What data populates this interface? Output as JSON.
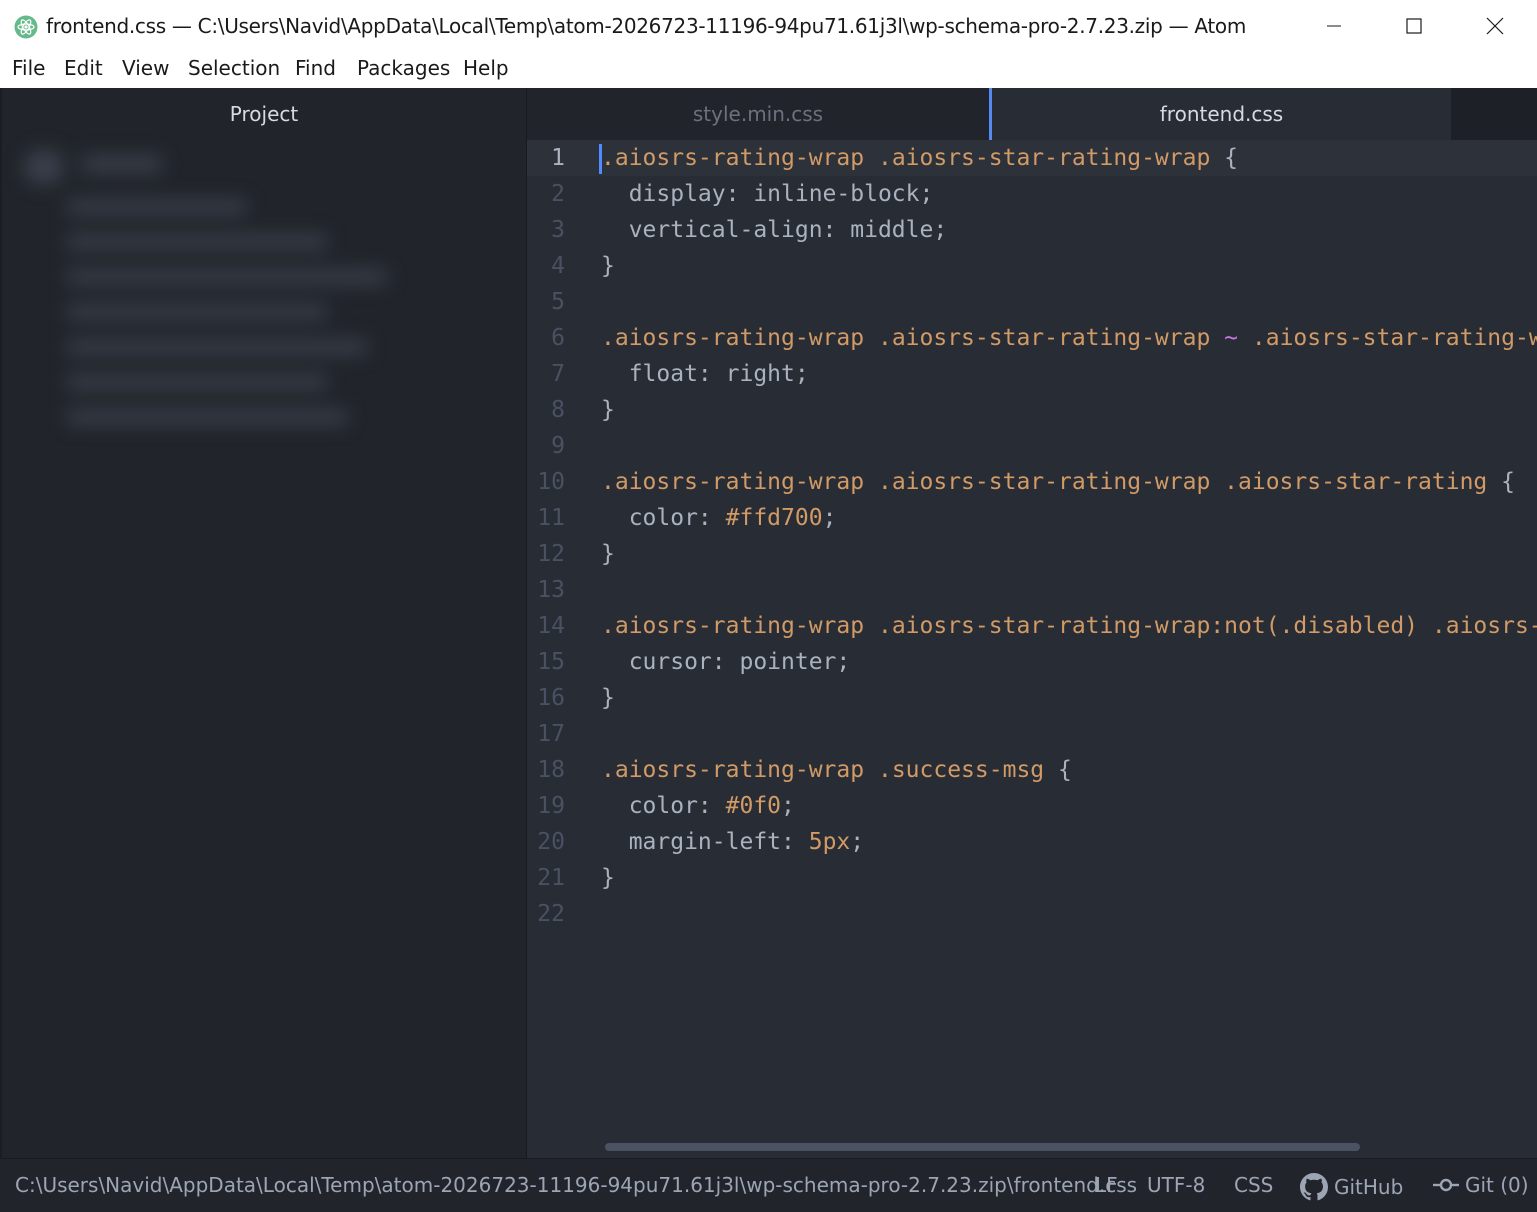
{
  "window": {
    "title": "frontend.css — C:\\Users\\Navid\\AppData\\Local\\Temp\\atom-2026723-11196-94pu71.61j3l\\wp-schema-pro-2.7.23.zip — Atom"
  },
  "menu": [
    "File",
    "Edit",
    "View",
    "Selection",
    "Find",
    "Packages",
    "Help"
  ],
  "project": {
    "header": "Project"
  },
  "tabs": [
    {
      "label": "style.min.css",
      "active": false
    },
    {
      "label": "frontend.css",
      "active": true
    }
  ],
  "editor": {
    "cursor_line": 1,
    "lines": [
      {
        "n": "1",
        "tokens": [
          {
            "t": ".aiosrs-rating-wrap",
            "c": "sel"
          },
          {
            "t": " ",
            "c": ""
          },
          {
            "t": ".aiosrs-star-rating-wrap",
            "c": "sel"
          },
          {
            "t": " {",
            "c": ""
          }
        ]
      },
      {
        "n": "2",
        "tokens": [
          {
            "t": "  display: inline-block;",
            "c": ""
          }
        ]
      },
      {
        "n": "3",
        "tokens": [
          {
            "t": "  vertical-align: middle;",
            "c": ""
          }
        ]
      },
      {
        "n": "4",
        "tokens": [
          {
            "t": "}",
            "c": ""
          }
        ]
      },
      {
        "n": "5",
        "tokens": []
      },
      {
        "n": "6",
        "tokens": [
          {
            "t": ".aiosrs-rating-wrap",
            "c": "sel"
          },
          {
            "t": " ",
            "c": ""
          },
          {
            "t": ".aiosrs-star-rating-wrap",
            "c": "sel"
          },
          {
            "t": " ",
            "c": ""
          },
          {
            "t": "~",
            "c": "tilde"
          },
          {
            "t": " ",
            "c": ""
          },
          {
            "t": ".aiosrs-star-rating-wra",
            "c": "sel"
          }
        ]
      },
      {
        "n": "7",
        "tokens": [
          {
            "t": "  float: right;",
            "c": ""
          }
        ]
      },
      {
        "n": "8",
        "tokens": [
          {
            "t": "}",
            "c": ""
          }
        ]
      },
      {
        "n": "9",
        "tokens": []
      },
      {
        "n": "10",
        "tokens": [
          {
            "t": ".aiosrs-rating-wrap",
            "c": "sel"
          },
          {
            "t": " ",
            "c": ""
          },
          {
            "t": ".aiosrs-star-rating-wrap",
            "c": "sel"
          },
          {
            "t": " ",
            "c": ""
          },
          {
            "t": ".aiosrs-star-rating",
            "c": "sel"
          },
          {
            "t": " {",
            "c": ""
          }
        ]
      },
      {
        "n": "11",
        "tokens": [
          {
            "t": "  color: ",
            "c": ""
          },
          {
            "t": "#ffd700",
            "c": "num"
          },
          {
            "t": ";",
            "c": ""
          }
        ]
      },
      {
        "n": "12",
        "tokens": [
          {
            "t": "}",
            "c": ""
          }
        ]
      },
      {
        "n": "13",
        "tokens": []
      },
      {
        "n": "14",
        "tokens": [
          {
            "t": ".aiosrs-rating-wrap",
            "c": "sel"
          },
          {
            "t": " ",
            "c": ""
          },
          {
            "t": ".aiosrs-star-rating-wrap:not(.disabled)",
            "c": "sel"
          },
          {
            "t": " ",
            "c": ""
          },
          {
            "t": ".aiosrs-st",
            "c": "sel"
          }
        ]
      },
      {
        "n": "15",
        "tokens": [
          {
            "t": "  cursor: pointer;",
            "c": ""
          }
        ]
      },
      {
        "n": "16",
        "tokens": [
          {
            "t": "}",
            "c": ""
          }
        ]
      },
      {
        "n": "17",
        "tokens": []
      },
      {
        "n": "18",
        "tokens": [
          {
            "t": ".aiosrs-rating-wrap",
            "c": "sel"
          },
          {
            "t": " ",
            "c": ""
          },
          {
            "t": ".success-msg",
            "c": "sel"
          },
          {
            "t": " {",
            "c": ""
          }
        ]
      },
      {
        "n": "19",
        "tokens": [
          {
            "t": "  color: ",
            "c": ""
          },
          {
            "t": "#0f0",
            "c": "num"
          },
          {
            "t": ";",
            "c": ""
          }
        ]
      },
      {
        "n": "20",
        "tokens": [
          {
            "t": "  margin-left: ",
            "c": ""
          },
          {
            "t": "5px",
            "c": "num"
          },
          {
            "t": ";",
            "c": ""
          }
        ]
      },
      {
        "n": "21",
        "tokens": [
          {
            "t": "}",
            "c": ""
          }
        ]
      },
      {
        "n": "22",
        "tokens": []
      }
    ]
  },
  "status": {
    "path": "C:\\Users\\Navid\\AppData\\Local\\Temp\\atom-2026723-11196-94pu71.61j3l\\wp-schema-pro-2.7.23.zip\\frontend.css",
    "line_ending": "LF",
    "encoding": "UTF-8",
    "grammar": "CSS",
    "github": "GitHub",
    "git": "Git (0)"
  },
  "icons": {
    "app": "atom-logo-icon",
    "minimize": "minimize-icon",
    "maximize": "maximize-icon",
    "close": "close-icon",
    "github": "github-icon",
    "git": "git-commit-icon"
  },
  "colors": {
    "accent": "#568af2",
    "selector": "#d19a66",
    "text": "#abb2bf",
    "editor_bg": "#282c34",
    "panel_bg": "#21252b"
  }
}
